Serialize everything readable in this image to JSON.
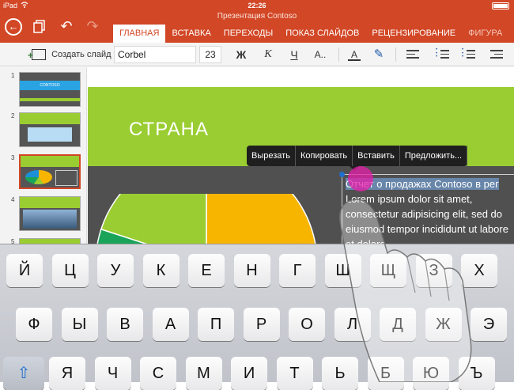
{
  "status_bar": {
    "carrier": "iPad",
    "time": "22:26"
  },
  "window": {
    "doc_title": "Презентация Contoso"
  },
  "toolbar": {
    "back_icon": "back-arrow-icon",
    "files_icon": "files-icon",
    "undo_icon": "undo-icon",
    "redo_icon": "redo-icon"
  },
  "tabs": [
    {
      "label": "ГЛАВНАЯ"
    },
    {
      "label": "ВСТАВКА"
    },
    {
      "label": "ПЕРЕХОДЫ"
    },
    {
      "label": "ПОКАЗ СЛАЙДОВ"
    },
    {
      "label": "РЕЦЕНЗИРОВАНИЕ"
    },
    {
      "label": "ФИГУРА"
    }
  ],
  "ribbon": {
    "new_slide_label": "Создать слайд",
    "font_name": "Corbel",
    "font_size": "23",
    "bold": "Ж",
    "italic": "К",
    "underline": "Ч",
    "more_format": "А..",
    "font_color": "А"
  },
  "thumbnails": [
    {
      "number": "1",
      "title": "CONTOSO"
    },
    {
      "number": "2"
    },
    {
      "number": "3"
    },
    {
      "number": "4"
    },
    {
      "number": "5"
    }
  ],
  "slide": {
    "title": "СТРАНА",
    "text_selected": "Отчет о продажах Contoso в рег",
    "text_body": "Lorem ipsum dolor sit amet, consectetur adipisicing elit, sed do eiusmod tempor incididunt ut labore et dolore",
    "chart_data": {
      "type": "pie",
      "colors": [
        "#f7b500",
        "#1d8fd6",
        "#1aa45a",
        "#9acd32"
      ],
      "values": [
        40,
        25,
        15,
        20
      ]
    }
  },
  "context_menu": {
    "items": [
      {
        "label": "Вырезать"
      },
      {
        "label": "Копировать"
      },
      {
        "label": "Вставить"
      },
      {
        "label": "Предложить..."
      }
    ]
  },
  "keyboard": {
    "row1": [
      "Й",
      "Ц",
      "У",
      "К",
      "Е",
      "Н",
      "Г",
      "Ш",
      "Щ",
      "З",
      "Х"
    ],
    "row2": [
      "Ф",
      "Ы",
      "В",
      "А",
      "П",
      "Р",
      "О",
      "Л",
      "Д",
      "Ж",
      "Э"
    ],
    "row3": [
      "Я",
      "Ч",
      "С",
      "М",
      "И",
      "Т",
      "Ь",
      "Б",
      "Ю",
      "Ъ"
    ],
    "shift_icon": "shift-arrow-icon"
  }
}
